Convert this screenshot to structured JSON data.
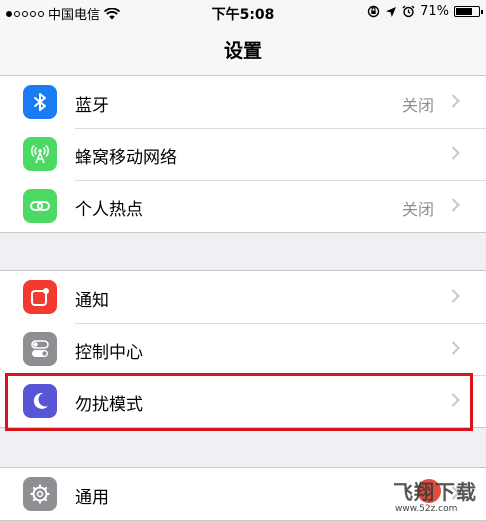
{
  "status_bar": {
    "carrier": "中国电信",
    "time": "下午5:08",
    "battery_percent": "71%",
    "battery_level": 0.71,
    "icons": [
      "signal-dots-icon",
      "wifi-icon",
      "orientation-lock-icon",
      "location-arrow-icon",
      "alarm-clock-icon",
      "battery-icon"
    ]
  },
  "nav": {
    "title": "设置"
  },
  "groups": [
    {
      "items": [
        {
          "label": "蓝牙",
          "value": "关闭",
          "icon": "bluetooth-icon",
          "color": "#1a7cf3"
        },
        {
          "label": "蜂窝移动网络",
          "value": "",
          "icon": "cellular-antenna-icon",
          "color": "#4cd964"
        },
        {
          "label": "个人热点",
          "value": "关闭",
          "icon": "personal-hotspot-icon",
          "color": "#4cd964"
        }
      ]
    },
    {
      "items": [
        {
          "label": "通知",
          "value": "",
          "icon": "notifications-icon",
          "color": "#f33a2f"
        },
        {
          "label": "控制中心",
          "value": "",
          "icon": "control-center-icon",
          "color": "#8e8e93"
        },
        {
          "label": "勿扰模式",
          "value": "",
          "icon": "moon-icon",
          "color": "#5856d6"
        }
      ]
    },
    {
      "items": [
        {
          "label": "通用",
          "value": "",
          "icon": "gear-icon",
          "color": "#8e8e93"
        }
      ]
    }
  ],
  "highlight": {
    "target": "勿扰模式",
    "color": "#d7141c"
  },
  "watermark": {
    "title": "飞翔下载",
    "url": "www.52z.com"
  }
}
